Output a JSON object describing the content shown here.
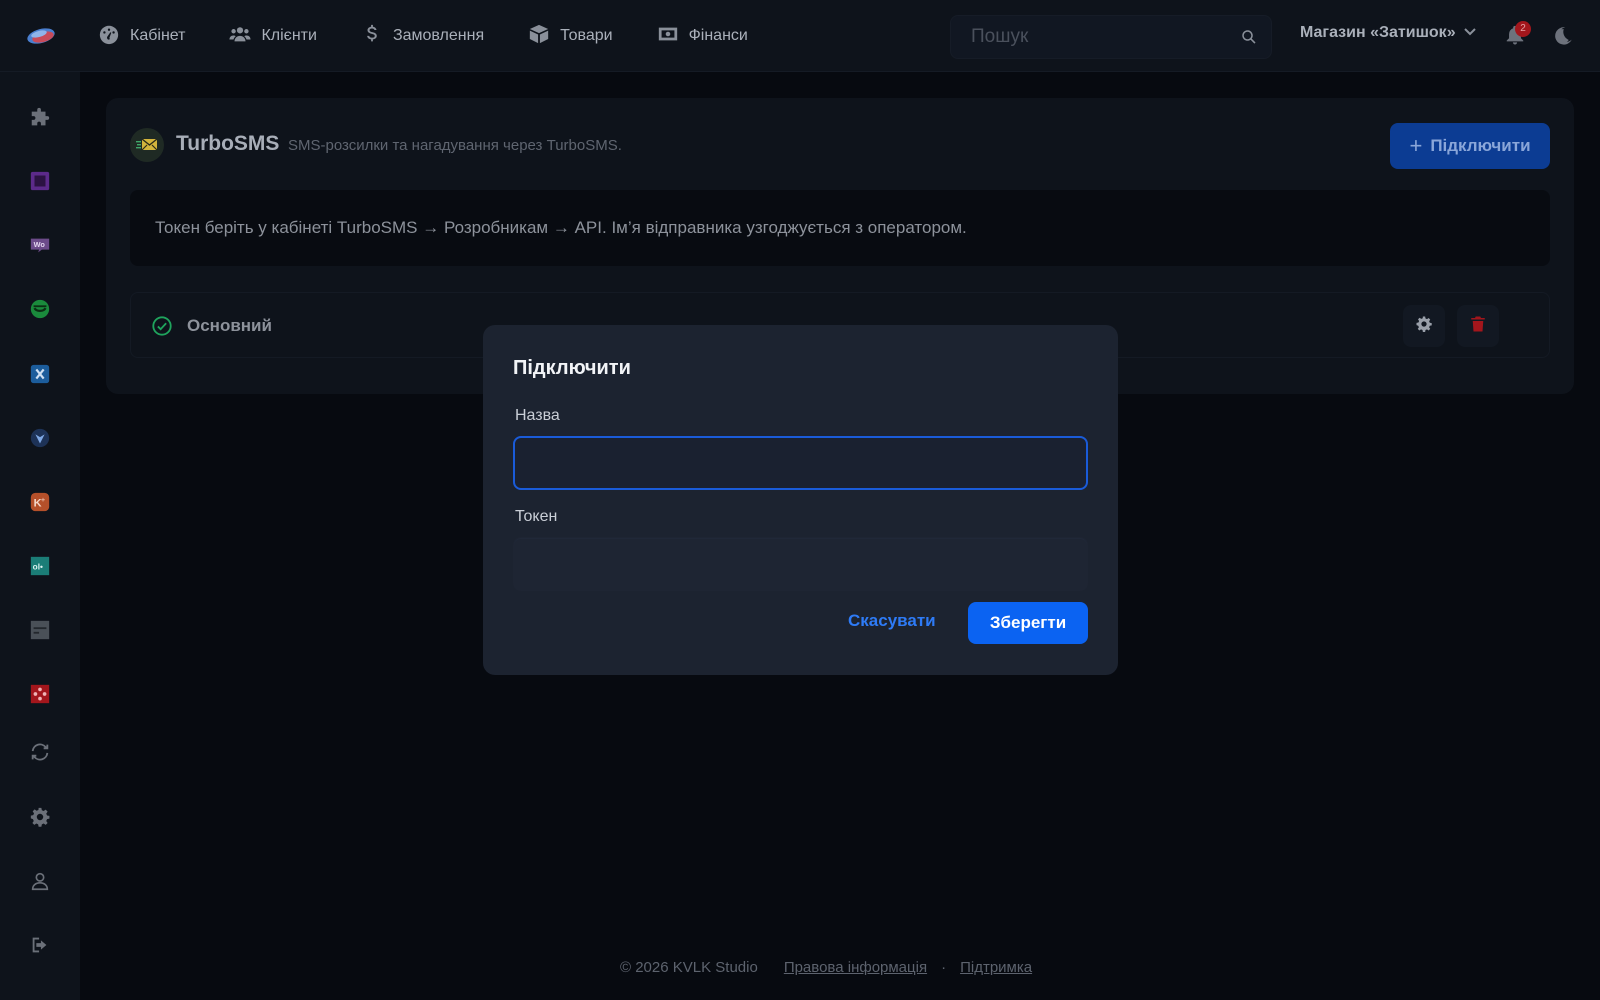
{
  "header": {
    "nav": [
      {
        "label": "Кабінет",
        "icon": "dashboard-icon"
      },
      {
        "label": "Клієнти",
        "icon": "users-icon"
      },
      {
        "label": "Замовлення",
        "icon": "dollar-icon"
      },
      {
        "label": "Товари",
        "icon": "box-icon"
      },
      {
        "label": "Фінанси",
        "icon": "money-icon"
      }
    ],
    "search_placeholder": "Пошук",
    "store_name": "Магазин «Затишок»",
    "notifications_count": "2"
  },
  "sidebar": {
    "items": [
      "puzzle-icon",
      "square-app-icon",
      "woo-icon",
      "smile-app-icon",
      "x-app-icon",
      "heart-app-icon",
      "kplus-app-icon",
      "olx-app-icon",
      "tab-app-icon",
      "nodes-app-icon",
      "sync-icon",
      "gear-icon",
      "user-icon",
      "logout-icon"
    ]
  },
  "integration": {
    "name": "TurboSMS",
    "description": "SMS-розсилки та нагадування через TurboSMS.",
    "connect_label": "Підключити",
    "info_parts": [
      "Токен беріть у кабінеті",
      "TurboSMS",
      "→",
      "Розробникам",
      "→",
      "API.",
      "Ім’я відправника узгоджується з оператором."
    ],
    "connection": {
      "name": "Основний",
      "status": "active"
    }
  },
  "modal": {
    "title": "Підключити",
    "name_label": "Назва",
    "name_value": "",
    "token_label": "Токен",
    "token_value": "",
    "cancel_label": "Скасувати",
    "save_label": "Зберегти"
  },
  "footer": {
    "copyright": "© 2026 KVLK Studio",
    "legal": "Правова інформація",
    "separator": "·",
    "support": "Підтримка"
  },
  "colors": {
    "accent": "#0b63f2",
    "background": "#070a10",
    "surface": "#0e131b",
    "modal": "#1c2330",
    "danger": "#a3161c",
    "success": "#1fa45d"
  }
}
